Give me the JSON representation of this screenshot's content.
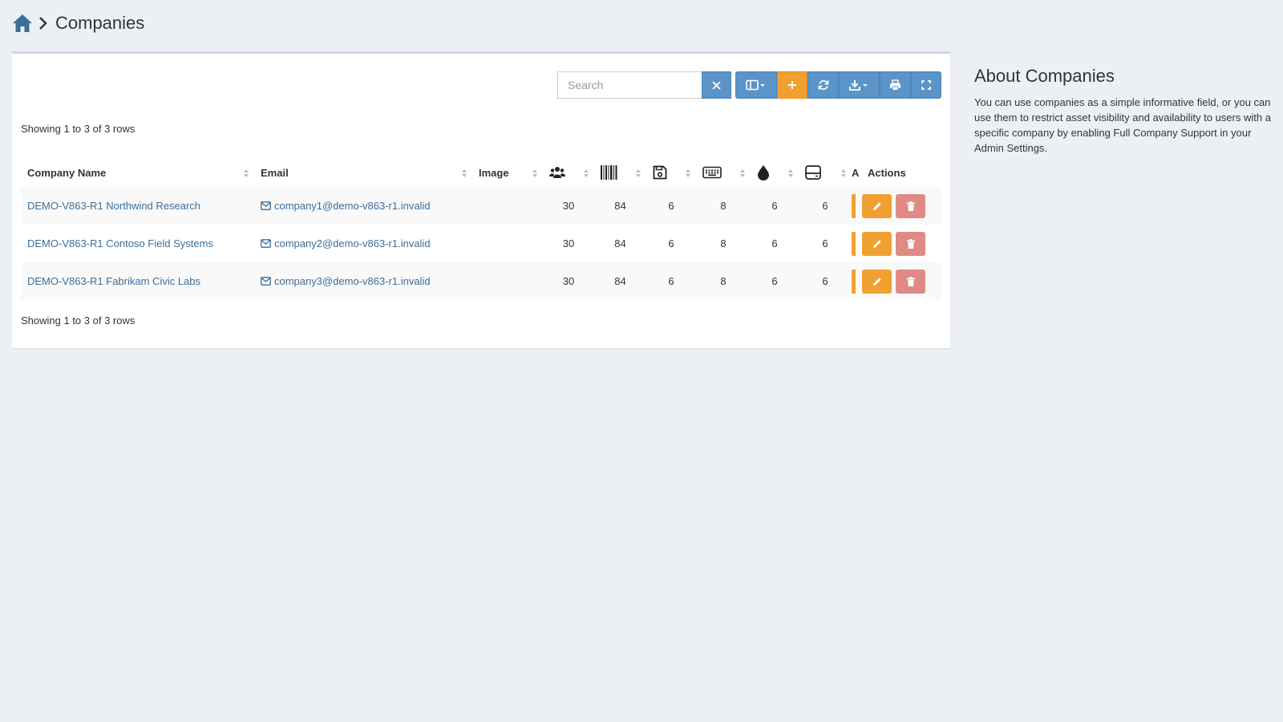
{
  "breadcrumb": {
    "title": "Companies"
  },
  "toolbar": {
    "search_placeholder": "Search"
  },
  "table": {
    "showing_top": "Showing 1 to 3 of 3 rows",
    "showing_bottom": "Showing 1 to 3 of 3 rows",
    "headers": {
      "name": "Company Name",
      "email": "Email",
      "image": "Image",
      "truncated": "A",
      "actions": "Actions"
    },
    "header_icons": [
      "users-icon",
      "barcode-icon",
      "floppy-disk-icon",
      "keyboard-icon",
      "droplet-icon",
      "hard-drive-icon"
    ],
    "rows": [
      {
        "name": "DEMO-V863-R1 Northwind Research",
        "email": "company1@demo-v863-r1.invalid",
        "users": "30",
        "assets": "84",
        "licenses": "6",
        "accessories": "8",
        "consumables": "6",
        "components": "6"
      },
      {
        "name": "DEMO-V863-R1 Contoso Field Systems",
        "email": "company2@demo-v863-r1.invalid",
        "users": "30",
        "assets": "84",
        "licenses": "6",
        "accessories": "8",
        "consumables": "6",
        "components": "6"
      },
      {
        "name": "DEMO-V863-R1 Fabrikam Civic Labs",
        "email": "company3@demo-v863-r1.invalid",
        "users": "30",
        "assets": "84",
        "licenses": "6",
        "accessories": "8",
        "consumables": "6",
        "components": "6"
      }
    ]
  },
  "about": {
    "title": "About Companies",
    "text": "You can use companies as a simple informative field, or you can use them to restrict asset visibility and availability to users with a specific company by enabling Full Company Support in your Admin Settings."
  },
  "colors": {
    "primary": "#5a94c9",
    "warning": "#f0a030",
    "danger": "#e08a85",
    "link": "#3c6e9a",
    "background": "#ecf0f5"
  }
}
